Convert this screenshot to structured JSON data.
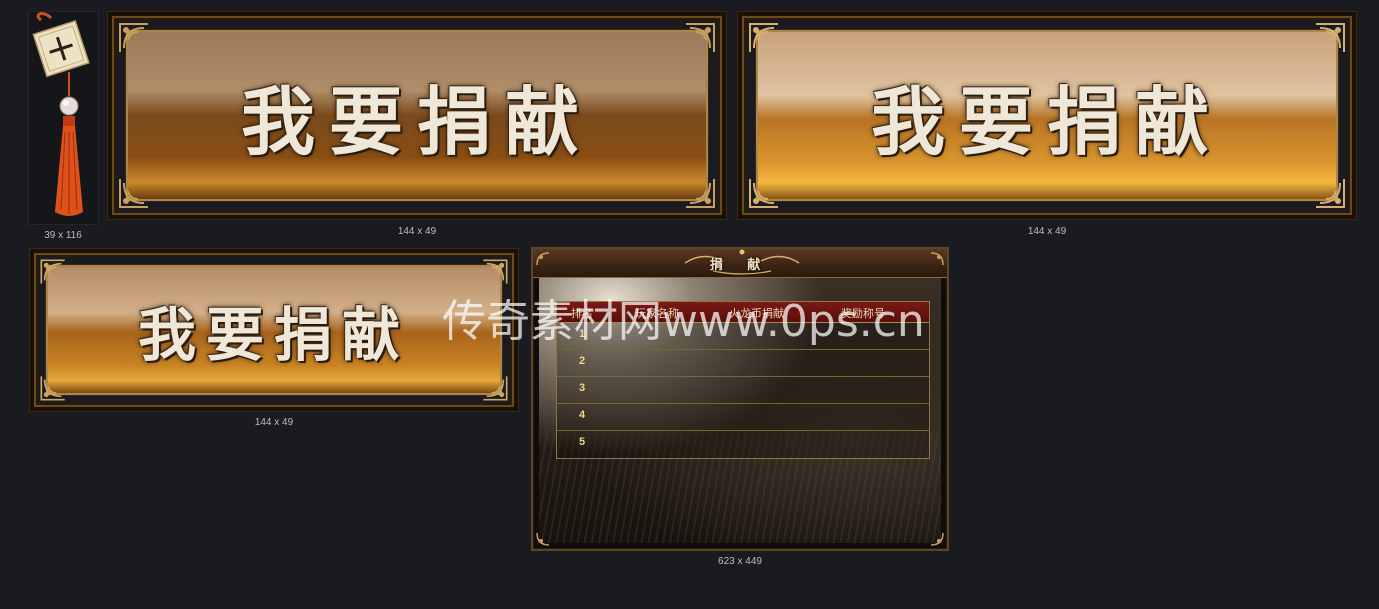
{
  "assets": [
    {
      "size_label": "39 x 116"
    },
    {
      "size_label": "144 x 49",
      "button_text": "我要捐献"
    },
    {
      "size_label": "144 x 49",
      "button_text": "我要捐献"
    },
    {
      "size_label": "144 x 49",
      "button_text": "我要捐献"
    },
    {
      "size_label": "623 x 449"
    }
  ],
  "panel": {
    "title": "捐 献",
    "columns": [
      "排名",
      "玩家名称",
      "火龙币捐献",
      "奖励称号"
    ],
    "ranks": [
      "1",
      "2",
      "3",
      "4",
      "5"
    ]
  },
  "watermark": "传奇素材网www.0ps.cn",
  "colors": {
    "background": "#191b20",
    "gold_border": "#a8864e",
    "rank_text": "#f2d48a",
    "header_red": "#7a1a14"
  },
  "icons": [
    "tassel-icon",
    "corner-ornament-icon"
  ]
}
